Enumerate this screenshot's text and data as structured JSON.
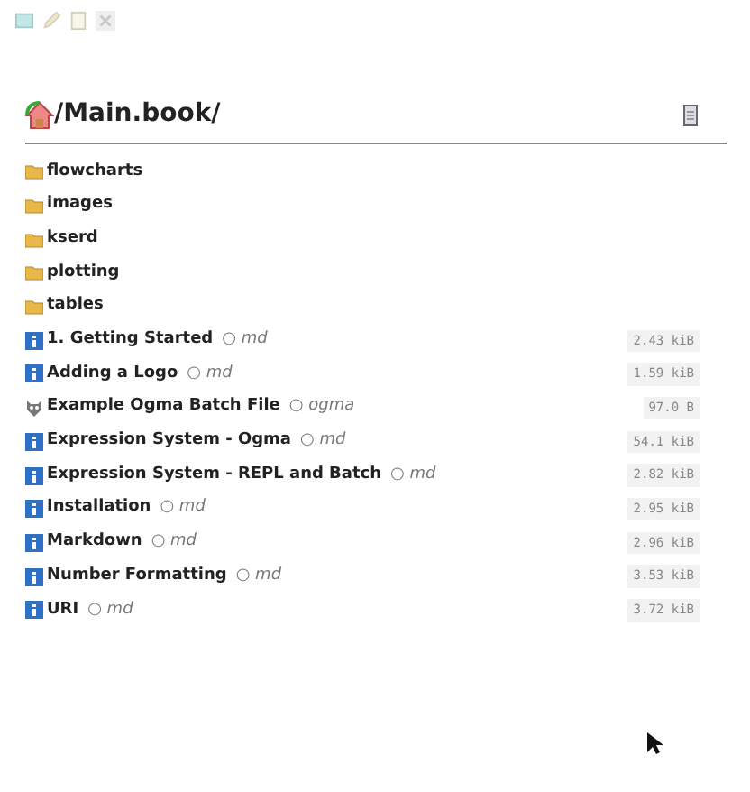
{
  "title": "/Main.book/",
  "entries": [
    {
      "kind": "folder",
      "name": "flowcharts"
    },
    {
      "kind": "folder",
      "name": "images"
    },
    {
      "kind": "folder",
      "name": "kserd"
    },
    {
      "kind": "folder",
      "name": "plotting"
    },
    {
      "kind": "folder",
      "name": "tables"
    },
    {
      "kind": "info",
      "name": "1. Getting Started",
      "type": "○ md",
      "size": "2.43 kiB"
    },
    {
      "kind": "info",
      "name": "Adding a Logo",
      "type": "○ md",
      "size": "1.59 kiB"
    },
    {
      "kind": "ogma",
      "name": "Example Ogma Batch File",
      "type": "○ ogma",
      "size": "97.0 B"
    },
    {
      "kind": "info",
      "name": "Expression System - Ogma",
      "type": "○ md",
      "size": "54.1 kiB"
    },
    {
      "kind": "info",
      "name": "Expression System - REPL and Batch",
      "type": "○ md",
      "size": "2.82 kiB"
    },
    {
      "kind": "info",
      "name": "Installation",
      "type": "○ md",
      "size": "2.95 kiB"
    },
    {
      "kind": "info",
      "name": "Markdown",
      "type": "○ md",
      "size": "2.96 kiB"
    },
    {
      "kind": "info",
      "name": "Number Formatting",
      "type": "○ md",
      "size": "3.53 kiB"
    },
    {
      "kind": "info",
      "name": "URI",
      "type": "○ md",
      "size": "3.72 kiB"
    }
  ]
}
